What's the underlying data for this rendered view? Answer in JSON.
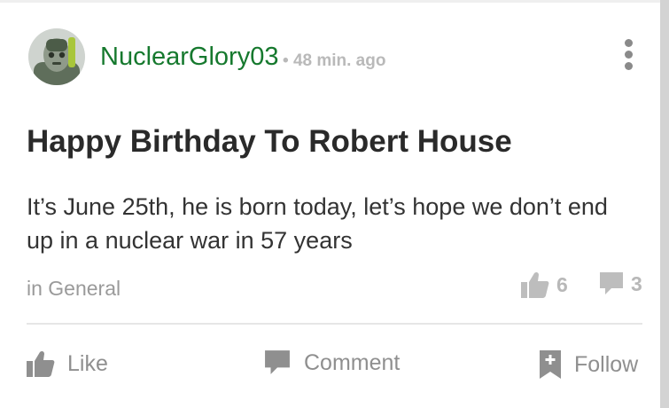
{
  "post": {
    "author": "NuclearGlory03",
    "time": "48 min. ago",
    "meta_separator": "•",
    "title": "Happy Birthday To Robert House",
    "body": "It’s June 25th, he is born today, let’s hope we don’t end up in a nuclear war in 57 years",
    "category": "in General",
    "likes": "6",
    "comments": "3"
  },
  "actions": {
    "like_label": "Like",
    "comment_label": "Comment",
    "follow_label": "Follow"
  },
  "colors": {
    "username": "#16792e",
    "muted": "#8f8f8f",
    "stat": "#b8b8b8"
  },
  "icons": {
    "menu": "vertical-dots-icon",
    "like": "thumbs-up-icon",
    "comment": "speech-bubble-icon",
    "follow": "bookmark-plus-icon"
  }
}
